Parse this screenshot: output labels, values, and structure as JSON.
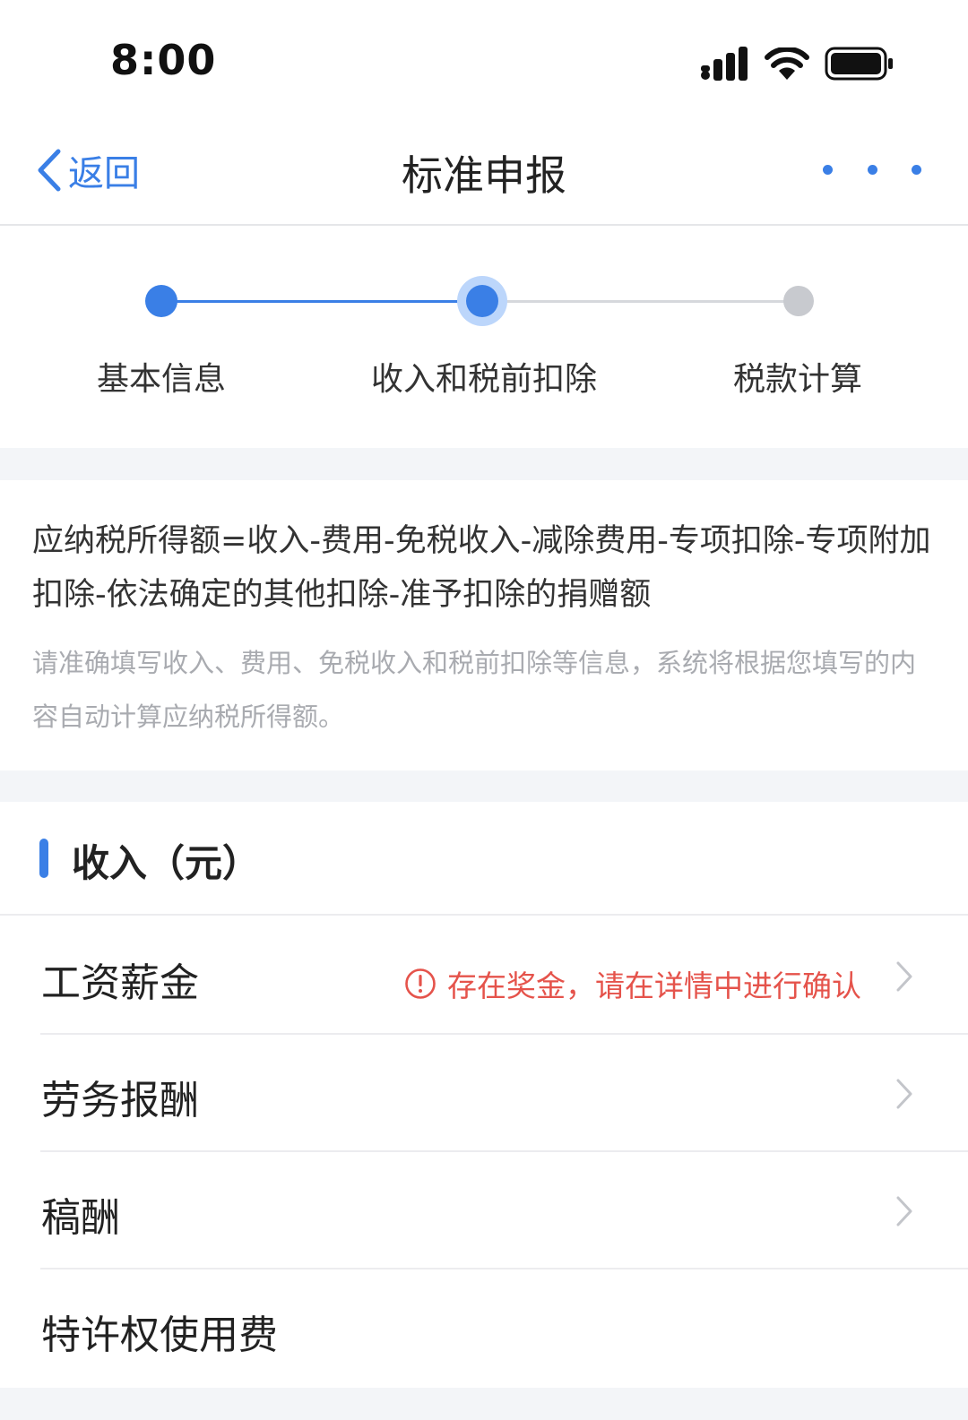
{
  "status_bar": {
    "time": "8:00"
  },
  "navbar": {
    "back_label": "返回",
    "title": "标准申报"
  },
  "steps": [
    {
      "label": "基本信息",
      "state": "done"
    },
    {
      "label": "收入和税前扣除",
      "state": "current"
    },
    {
      "label": "税款计算",
      "state": "todo"
    }
  ],
  "formula": {
    "text": "应纳税所得额=收入-费用-免税收入-减除费用-专项扣除-专项附加扣除-依法确定的其他扣除-准予扣除的捐赠额",
    "note": "请准确填写收入、费用、免税收入和税前扣除等信息，系统将根据您填写的内容自动计算应纳税所得额。"
  },
  "income": {
    "title": "收入（元）",
    "rows": [
      {
        "label": "工资薪金",
        "warning": "存在奖金，请在详情中进行确认"
      },
      {
        "label": "劳务报酬"
      },
      {
        "label": "稿酬"
      },
      {
        "label": "特许权使用费"
      }
    ]
  },
  "colors": {
    "accent": "#3a7fe6",
    "warning": "#e5534b",
    "inactive_step": "#c8cacf"
  }
}
